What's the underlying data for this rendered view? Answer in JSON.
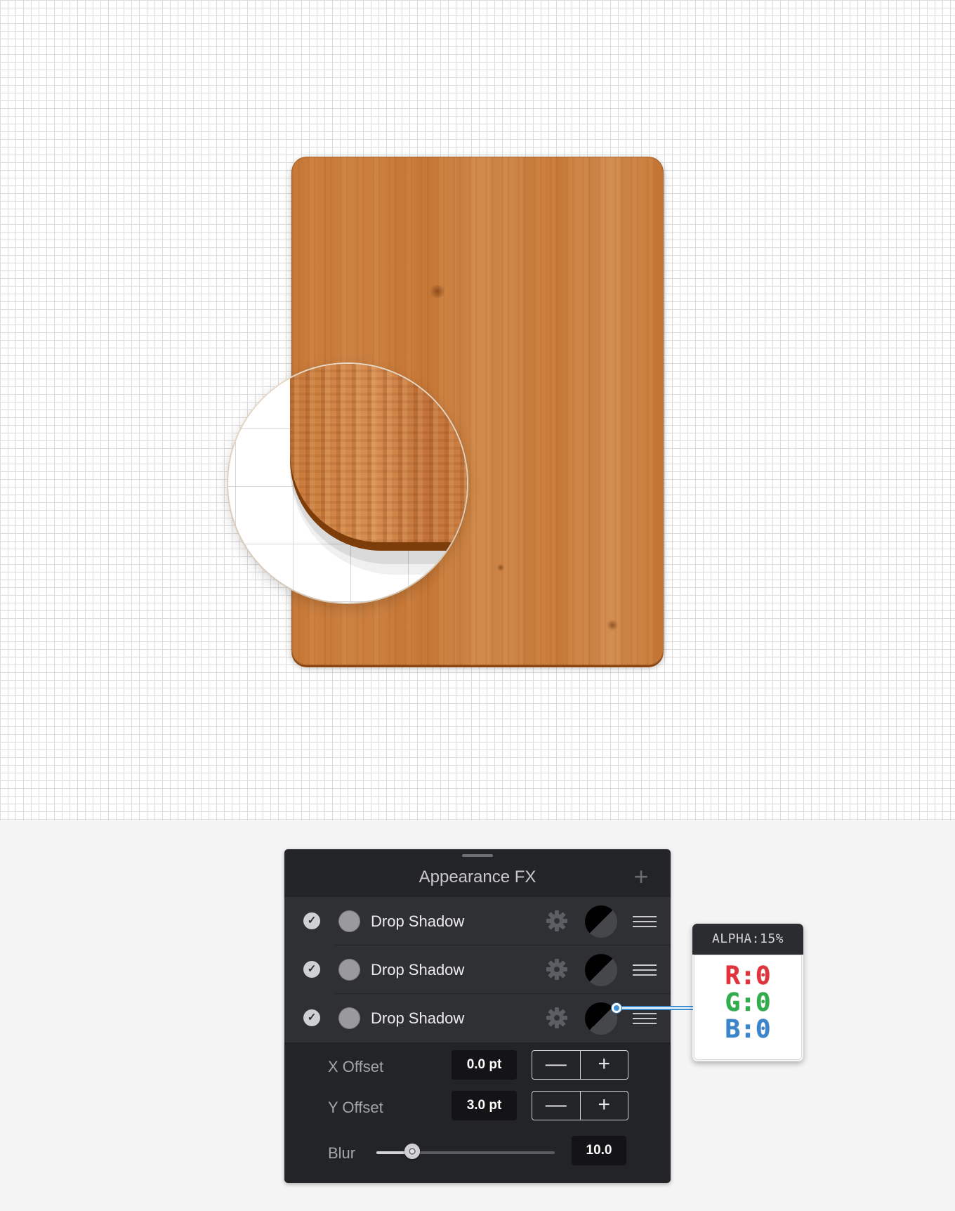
{
  "panel": {
    "title": "Appearance FX",
    "add_icon": "plus-icon",
    "effects": [
      {
        "label": "Drop Shadow",
        "enabled": true,
        "color": "#9a9a9d",
        "blend_icon": "blend-mode-icon"
      },
      {
        "label": "Drop Shadow",
        "enabled": true,
        "color": "#9a9a9d",
        "blend_icon": "blend-mode-icon"
      },
      {
        "label": "Drop Shadow",
        "enabled": true,
        "color": "#9a9a9d",
        "blend_icon": "blend-mode-icon"
      }
    ],
    "x_offset": {
      "label": "X Offset",
      "value": "0.0 pt"
    },
    "y_offset": {
      "label": "Y Offset",
      "value": "3.0 pt"
    },
    "blur": {
      "label": "Blur",
      "value": "10.0",
      "slider_fraction": 0.2
    },
    "stepper": {
      "minus": "—",
      "plus": "+"
    }
  },
  "color_tooltip": {
    "alpha": "ALPHA:15%",
    "r": "R:0",
    "g": "G:0",
    "b": "B:0"
  },
  "colors": {
    "wood": "#c77836",
    "panel_bg": "#232427",
    "row_bg": "#2f3034",
    "connector": "#3d8fd6"
  }
}
